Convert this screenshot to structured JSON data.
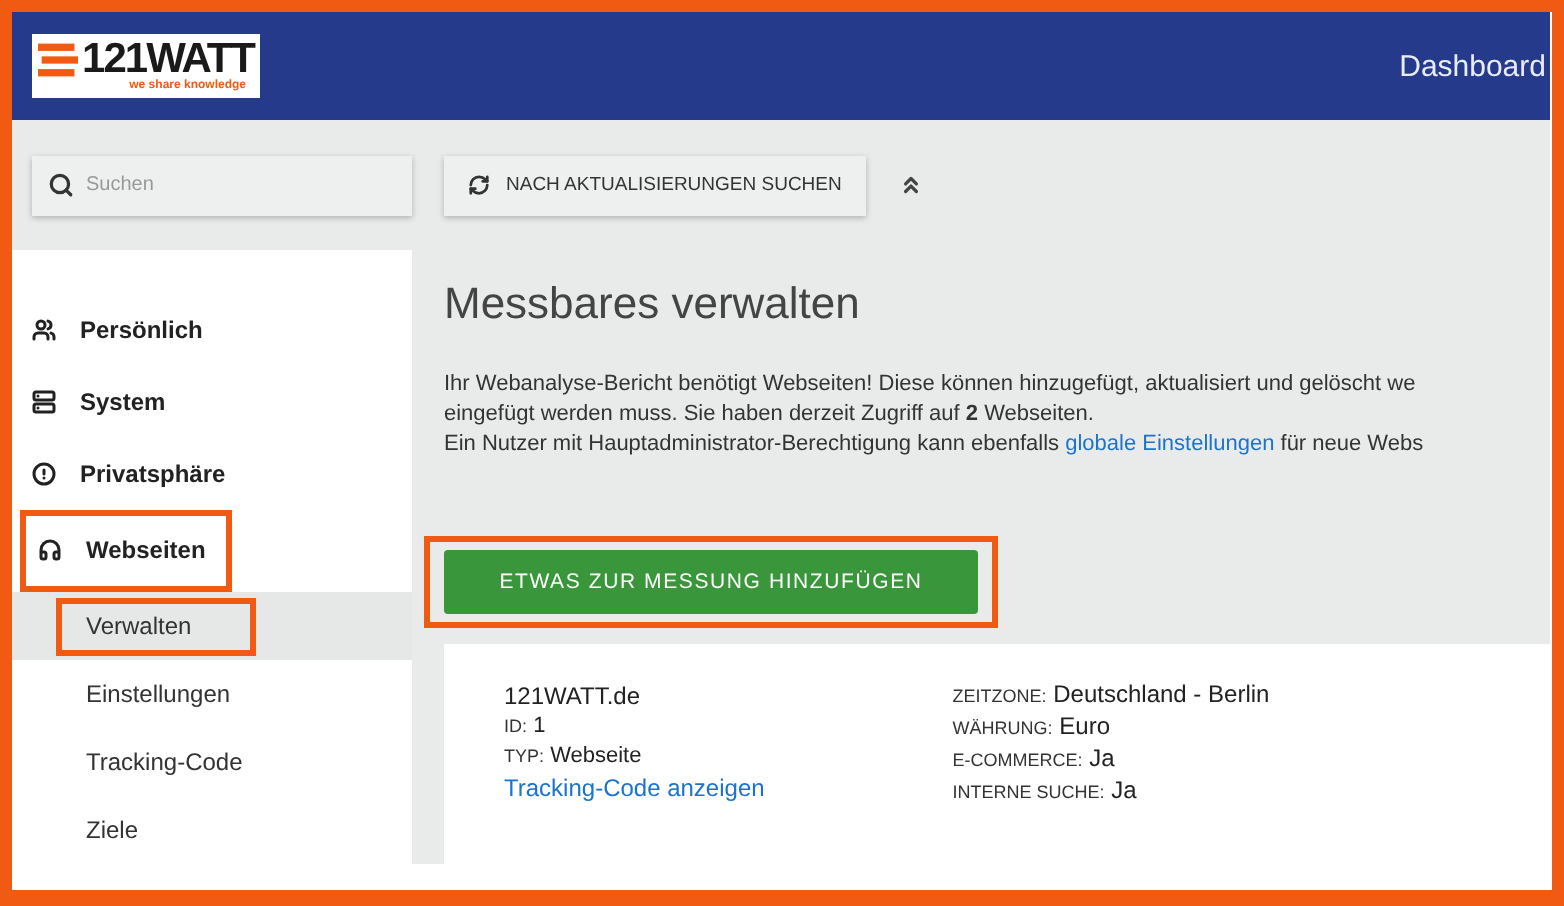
{
  "header": {
    "logo": {
      "wordmark": "121WATT",
      "tagline": "we share knowledge"
    },
    "nav_link": "Dashboard"
  },
  "search": {
    "placeholder": "Suchen"
  },
  "update_button": {
    "label": "NACH AKTUALISIERUNGEN SUCHEN"
  },
  "sidebar": {
    "items": [
      {
        "label": "Persönlich",
        "highlighted": false
      },
      {
        "label": "System",
        "highlighted": false
      },
      {
        "label": "Privatsphäre",
        "highlighted": false
      },
      {
        "label": "Webseiten",
        "highlighted": true,
        "children": [
          {
            "label": "Verwalten",
            "selected": true,
            "highlighted": true
          },
          {
            "label": "Einstellungen",
            "selected": false,
            "highlighted": false
          },
          {
            "label": "Tracking-Code",
            "selected": false,
            "highlighted": false
          },
          {
            "label": "Ziele",
            "selected": false,
            "highlighted": false
          }
        ]
      }
    ]
  },
  "main": {
    "title": "Messbares verwalten",
    "intro": [
      "Ihr Webanalyse-Bericht benötigt Webseiten! Diese können hinzugefügt, aktualisiert und gelöscht we",
      "eingefügt werden muss. Sie haben derzeit Zugriff auf **2** Webseiten."
    ],
    "admin_note": {
      "before": "Ein Nutzer mit Hauptadministrator-Berechtigung kann ebenfalls ",
      "link": "globale Einstellungen",
      "after": " für neue Webs"
    },
    "add_button": {
      "label": "ETWAS ZUR MESSUNG HINZUFÜGEN",
      "highlighted": true
    },
    "site": {
      "name": "121WATT.de",
      "details": [
        {
          "label": "ID:",
          "value": "1"
        },
        {
          "label": "TYP:",
          "value": "Webseite"
        }
      ],
      "link": "Tracking-Code anzeigen",
      "settings": [
        {
          "label": "ZEITZONE:",
          "value": "Deutschland - Berlin"
        },
        {
          "label": "WÄHRUNG:",
          "value": "Euro"
        },
        {
          "label": "E-COMMERCE:",
          "value": "Ja"
        },
        {
          "label": "INTERNE SUCHE:",
          "value": "Ja"
        }
      ]
    }
  }
}
